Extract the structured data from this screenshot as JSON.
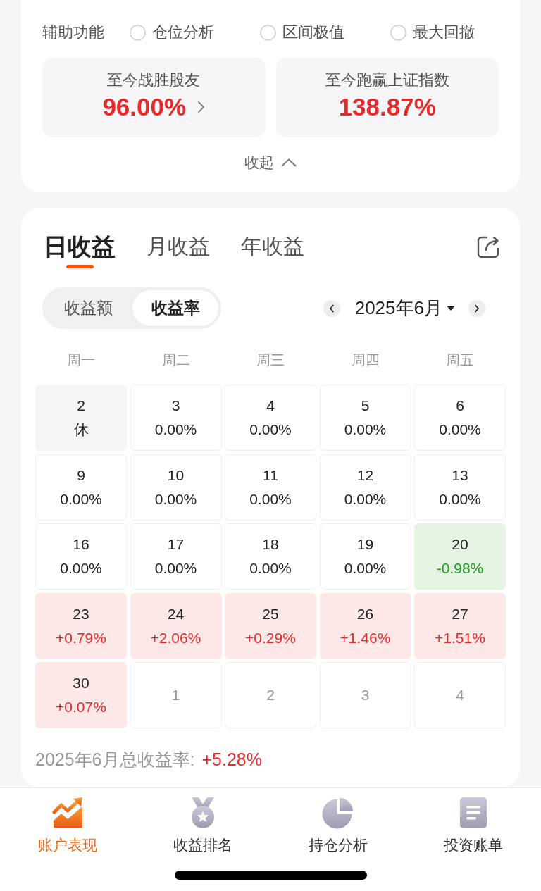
{
  "assist": {
    "label": "辅助功能",
    "options": [
      {
        "label": "仓位分析",
        "checked": false
      },
      {
        "label": "区间极值",
        "checked": false
      },
      {
        "label": "最大回撤",
        "checked": false
      }
    ]
  },
  "stats": [
    {
      "label": "至今战胜股友",
      "value": "96.00%",
      "chevron": true
    },
    {
      "label": "至今跑赢上证指数",
      "value": "138.87%",
      "chevron": false
    }
  ],
  "collapse": {
    "label": "收起"
  },
  "tabs": [
    {
      "label": "日收益",
      "selected": true
    },
    {
      "label": "月收益",
      "selected": false
    },
    {
      "label": "年收益",
      "selected": false
    }
  ],
  "segments": [
    {
      "label": "收益额",
      "selected": false
    },
    {
      "label": "收益率",
      "selected": true
    }
  ],
  "month": {
    "label": "2025年6月"
  },
  "weekdays": [
    "周一",
    "周二",
    "周三",
    "周四",
    "周五"
  ],
  "days": [
    {
      "day": "2",
      "value": "休",
      "kind": "holiday"
    },
    {
      "day": "3",
      "value": "0.00%",
      "kind": "flat"
    },
    {
      "day": "4",
      "value": "0.00%",
      "kind": "flat"
    },
    {
      "day": "5",
      "value": "0.00%",
      "kind": "flat"
    },
    {
      "day": "6",
      "value": "0.00%",
      "kind": "flat"
    },
    {
      "day": "9",
      "value": "0.00%",
      "kind": "flat"
    },
    {
      "day": "10",
      "value": "0.00%",
      "kind": "flat"
    },
    {
      "day": "11",
      "value": "0.00%",
      "kind": "flat"
    },
    {
      "day": "12",
      "value": "0.00%",
      "kind": "flat"
    },
    {
      "day": "13",
      "value": "0.00%",
      "kind": "flat"
    },
    {
      "day": "16",
      "value": "0.00%",
      "kind": "flat"
    },
    {
      "day": "17",
      "value": "0.00%",
      "kind": "flat"
    },
    {
      "day": "18",
      "value": "0.00%",
      "kind": "flat"
    },
    {
      "day": "19",
      "value": "0.00%",
      "kind": "flat"
    },
    {
      "day": "20",
      "value": "-0.98%",
      "kind": "down"
    },
    {
      "day": "23",
      "value": "+0.79%",
      "kind": "up"
    },
    {
      "day": "24",
      "value": "+2.06%",
      "kind": "up"
    },
    {
      "day": "25",
      "value": "+0.29%",
      "kind": "up"
    },
    {
      "day": "26",
      "value": "+1.46%",
      "kind": "up"
    },
    {
      "day": "27",
      "value": "+1.51%",
      "kind": "up"
    },
    {
      "day": "30",
      "value": "+0.07%",
      "kind": "up"
    },
    {
      "day": "1",
      "kind": "next_month"
    },
    {
      "day": "2",
      "kind": "next_month"
    },
    {
      "day": "3",
      "kind": "next_month"
    },
    {
      "day": "4",
      "kind": "next_month"
    }
  ],
  "summary": {
    "label": "2025年6月总收益率:",
    "value": "+5.28%"
  },
  "bottom_nav": [
    {
      "label": "账户表现",
      "selected": true,
      "kind": "trend"
    },
    {
      "label": "收益排名",
      "selected": false,
      "kind": "medal"
    },
    {
      "label": "持仓分析",
      "selected": false,
      "kind": "pie"
    },
    {
      "label": "投资账单",
      "selected": false,
      "kind": "bill"
    }
  ]
}
